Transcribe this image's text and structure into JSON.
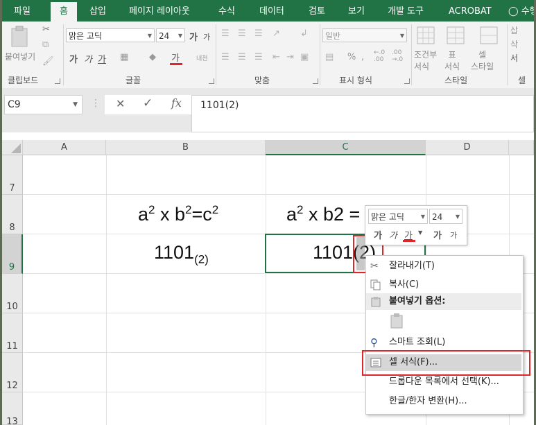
{
  "ribbon_tabs": [
    {
      "label": "파일"
    },
    {
      "label": "홈"
    },
    {
      "label": "삽입"
    },
    {
      "label": "페이지 레이아웃"
    },
    {
      "label": "수식"
    },
    {
      "label": "데이터"
    },
    {
      "label": "검토"
    },
    {
      "label": "보기"
    },
    {
      "label": "개발 도구"
    },
    {
      "label": "ACROBAT"
    },
    {
      "label": "수행"
    }
  ],
  "ribbon": {
    "clipboard": {
      "paste": "붙여넣기",
      "group": "클립보드"
    },
    "font": {
      "name": "맑은 고딕",
      "size": "24",
      "grow": "가",
      "shrink": "가",
      "bold": "가",
      "italic": "가",
      "underline": "가",
      "font_color_glyph": "가",
      "phonetic": "내천",
      "group": "글꼴"
    },
    "alignment": {
      "group": "맞춤"
    },
    "number": {
      "format": "일반",
      "percent": "%",
      "comma": ",",
      "inc_decimal": "←.0\n.00",
      "dec_decimal": ".00\n→.0",
      "group": "표시 형식"
    },
    "styles": {
      "conditional": "조건부\n서식",
      "table": "표\n서식",
      "cell": "셀\n스타일",
      "group": "스타일"
    },
    "cells": {
      "insert": "삽",
      "delete": "삭",
      "format": "서",
      "group": "셀"
    }
  },
  "formula_bar": {
    "name_box": "C9",
    "cancel": "✕",
    "enter": "✓",
    "fx": "fx",
    "content": "1101(2)"
  },
  "columns": [
    "A",
    "B",
    "C",
    "D"
  ],
  "rows": [
    "7",
    "8",
    "9",
    "10",
    "11",
    "12",
    "13"
  ],
  "cells": {
    "B8": {
      "a": "a",
      "a_exp": "2",
      "x": " x b",
      "b_exp": "2",
      "eq": "=c",
      "c_exp": "2"
    },
    "C8": {
      "a": "a",
      "a_exp": "2",
      "rest": " x b2 ="
    },
    "B9": {
      "main": "1101",
      "sub": "(2)"
    },
    "C9": {
      "main": "1101(2)"
    }
  },
  "mini_toolbar": {
    "font": "맑은 고딕",
    "size": "24",
    "bold": "가",
    "italic": "가",
    "underline": "가",
    "grow": "가",
    "shrink": "가"
  },
  "context_menu": {
    "items": [
      {
        "label": "잘라내기(T)"
      },
      {
        "label": "복사(C)"
      },
      {
        "label": "붙여넣기 옵션:"
      },
      {
        "label": "스마트 조회(L)"
      },
      {
        "label": "셀 서식(F)..."
      },
      {
        "label": "드롭다운 목록에서 선택(K)..."
      },
      {
        "label": "한글/한자 변환(H)..."
      }
    ]
  },
  "colors": {
    "excel_green": "#217346",
    "highlight_red": "#e0262b"
  }
}
